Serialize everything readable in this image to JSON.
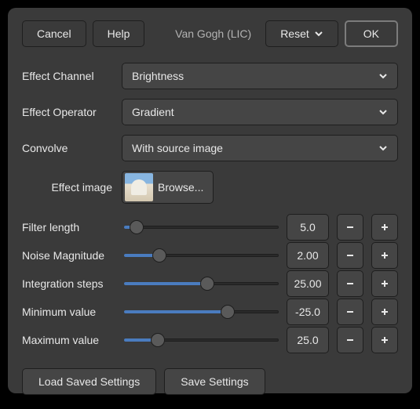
{
  "header": {
    "cancel": "Cancel",
    "help": "Help",
    "title": "Van Gogh (LIC)",
    "reset": "Reset",
    "ok": "OK"
  },
  "fields": {
    "effect_channel": {
      "label": "Effect Channel",
      "value": "Brightness"
    },
    "effect_operator": {
      "label": "Effect Operator",
      "value": "Gradient"
    },
    "convolve": {
      "label": "Convolve",
      "value": "With source image"
    },
    "effect_image": {
      "label": "Effect image",
      "browse": "Browse..."
    }
  },
  "sliders": [
    {
      "label": "Filter length",
      "value": "5.0",
      "pct": 8
    },
    {
      "label": "Noise Magnitude",
      "value": "2.00",
      "pct": 23
    },
    {
      "label": "Integration steps",
      "value": "25.00",
      "pct": 54
    },
    {
      "label": "Minimum value",
      "value": "-25.0",
      "pct": 67
    },
    {
      "label": "Maximum value",
      "value": "25.0",
      "pct": 22
    }
  ],
  "footer": {
    "load": "Load Saved Settings",
    "save": "Save Settings"
  }
}
